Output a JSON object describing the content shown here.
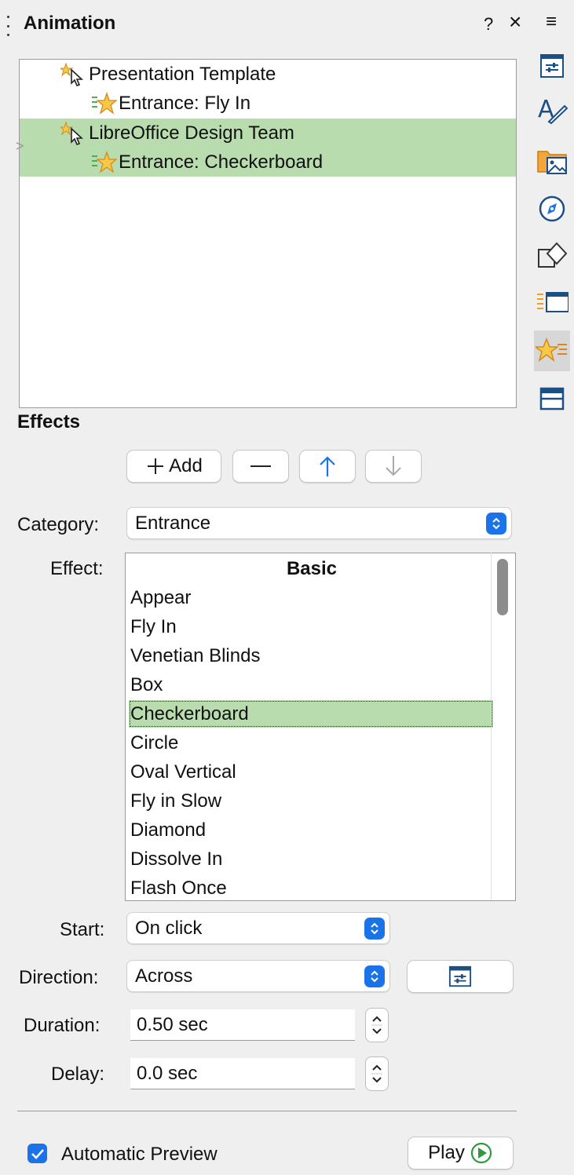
{
  "panel": {
    "title": "Animation",
    "help_label": "?",
    "close_label": "×",
    "menu_label": "≡"
  },
  "deck": {
    "icons": [
      "properties-icon",
      "styles-icon",
      "gallery-icon",
      "navigator-icon",
      "shapes-icon",
      "slide-transition-icon",
      "animation-icon",
      "master-slides-icon"
    ],
    "active": "animation-icon"
  },
  "tree": {
    "items": [
      {
        "label": "Presentation Template",
        "level": 0,
        "icon": "shape-cursor-icon",
        "selected": false
      },
      {
        "label": "Entrance: Fly In",
        "level": 1,
        "icon": "effect-star-icon",
        "selected": false
      },
      {
        "label": "LibreOffice Design Team",
        "level": 0,
        "icon": "shape-cursor-icon",
        "selected": true
      },
      {
        "label": "Entrance: Checkerboard",
        "level": 1,
        "icon": "effect-star-icon",
        "selected": true
      }
    ],
    "expander": ">"
  },
  "effects": {
    "heading": "Effects",
    "add_label": "Add",
    "remove_label": "—",
    "category_label": "Category:",
    "category_value": "Entrance",
    "effect_label": "Effect:",
    "effect_list": {
      "group_header": "Basic",
      "items": [
        "Appear",
        "Fly In",
        "Venetian Blinds",
        "Box",
        "Checkerboard",
        "Circle",
        "Oval Vertical",
        "Fly in Slow",
        "Diamond",
        "Dissolve In",
        "Flash Once"
      ],
      "selected": "Checkerboard"
    },
    "start_label": "Start:",
    "start_value": "On click",
    "direction_label": "Direction:",
    "direction_value": "Across",
    "duration_label": "Duration:",
    "duration_value": "0.50 sec",
    "delay_label": "Delay:",
    "delay_value": "0.0 sec"
  },
  "footer": {
    "auto_preview_label": "Automatic Preview",
    "auto_preview_checked": true,
    "play_label": "Play"
  },
  "colors": {
    "selection": "#b9dcae",
    "accent": "#1a73e8",
    "star": "#f0a020"
  }
}
